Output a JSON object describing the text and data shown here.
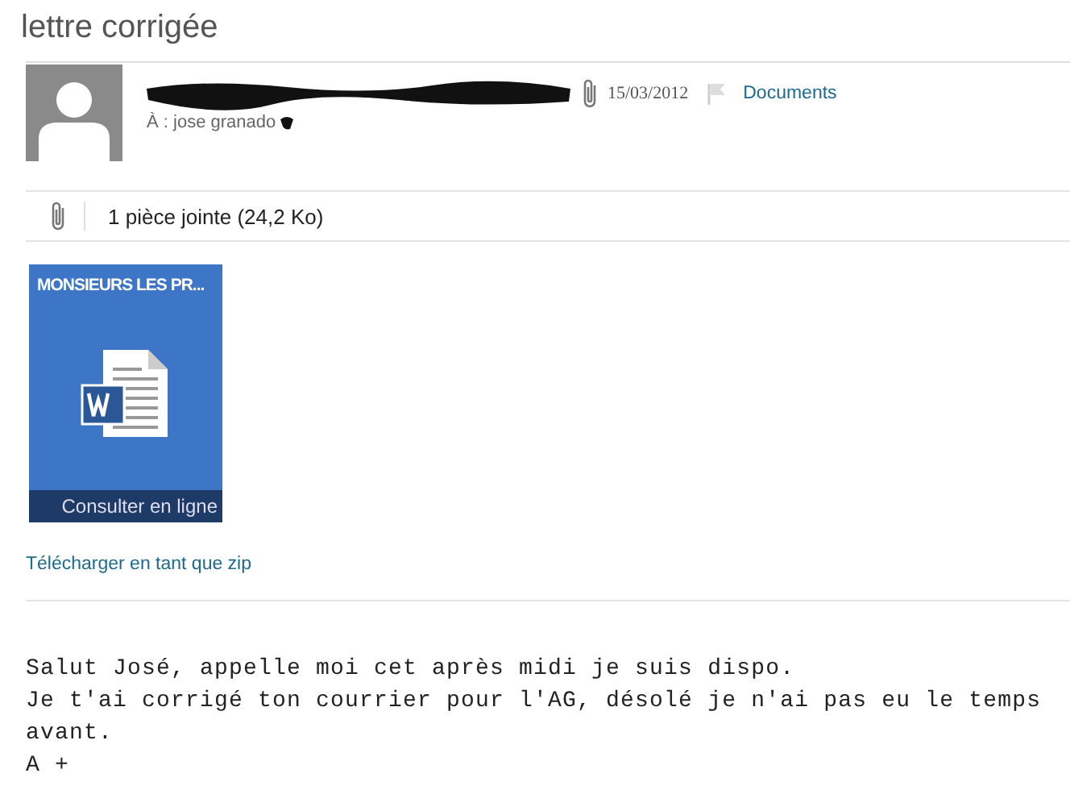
{
  "subject": "lettre corrigée",
  "message": {
    "date": "15/03/2012",
    "folder": "Documents",
    "recipient": "À : jose granado",
    "has_attachment": true
  },
  "attachments": {
    "summary": "1 pièce jointe (24,2 Ko)",
    "files": [
      {
        "title": "MONSIEURS LES PR...",
        "action": "Consulter en ligne"
      }
    ],
    "download_link": "Télécharger en tant que zip"
  },
  "body": [
    "Salut José, appelle moi cet après midi je suis dispo.",
    "Je t'ai corrigé ton courrier pour l'AG, désolé je n'ai pas eu le temps avant.",
    "A +"
  ]
}
